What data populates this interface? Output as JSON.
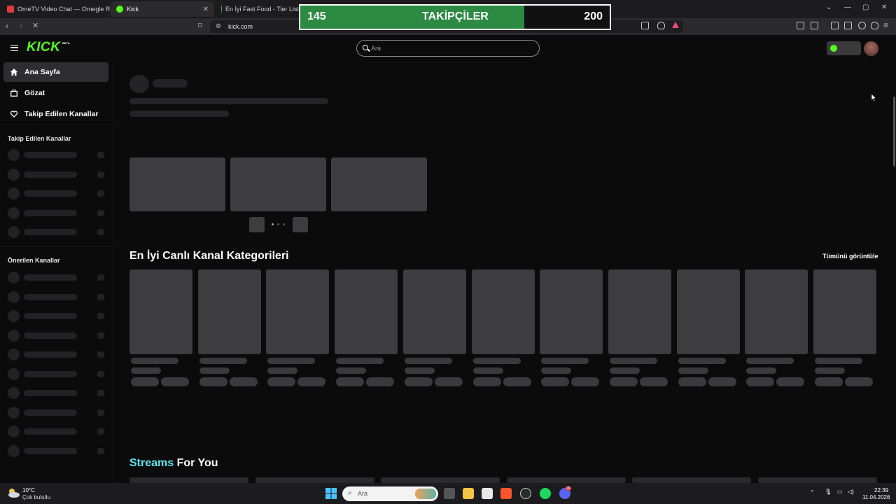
{
  "browser": {
    "tabs": [
      {
        "title": "OmeTV Video Chat — Omegle R"
      },
      {
        "title": "Kick"
      },
      {
        "title": "En İyi Fast Food - Tier List, K"
      }
    ],
    "url": "kick.com"
  },
  "overlay": {
    "current": "145",
    "label": "TAKİPÇİLER",
    "goal": "200",
    "progress": 0.725,
    "color": "#2c8a43"
  },
  "header": {
    "logo": "KICK",
    "beta": "BETA",
    "search_placeholder": "Ara"
  },
  "sidebar": {
    "nav": [
      {
        "label": "Ana Sayfa",
        "icon": "home-icon",
        "selected": true
      },
      {
        "label": "Gözat",
        "icon": "browse-icon"
      },
      {
        "label": "Takip Edilen Kanallar",
        "icon": "heart-icon"
      }
    ],
    "followed_heading": "Takip Edilen Kanallar",
    "recommended_heading": "Önerilen Kanallar"
  },
  "main": {
    "categories_title": "En İyi Canlı Kanal Kategorileri",
    "see_all": "Tümünü görüntüle",
    "streams_title_accent": "Streams",
    "streams_title_rest": " For You",
    "accent_color": "#53fc18",
    "streams_accent_color": "#5ee6f0"
  },
  "taskbar": {
    "weather_temp": "10°C",
    "weather_desc": "Çok bulutlu",
    "search_placeholder": "Ara",
    "time": "22:39",
    "date": "11.04.2026",
    "discord_badge": "99"
  }
}
